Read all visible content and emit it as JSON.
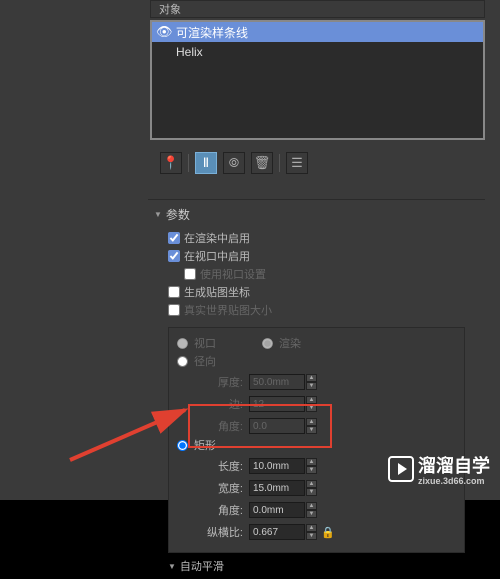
{
  "topbar": {
    "label": "对象"
  },
  "list": {
    "items": [
      {
        "label": "可渲染样条线",
        "selected": true,
        "eye": true
      },
      {
        "label": "Helix",
        "selected": false,
        "eye": false
      }
    ]
  },
  "toolbar": {
    "pin_icon": "📌",
    "info_icon": "ℹ",
    "lock_icon": "🔒",
    "trash_icon": "🗑",
    "config_icon": "⚙"
  },
  "params": {
    "section_title": "参数",
    "enable_render": {
      "label": "在渲染中启用",
      "checked": true
    },
    "enable_viewport": {
      "label": "在视口中启用",
      "checked": true
    },
    "use_viewport_settings": {
      "label": "使用视口设置",
      "checked": false
    },
    "gen_map_coords": {
      "label": "生成贴图坐标",
      "checked": false
    },
    "real_world_map": {
      "label": "真实世界贴图大小",
      "checked": false
    },
    "radial": {
      "viewport_label": "视口",
      "render_label": "渲染",
      "title": "径向",
      "thickness_label": "厚度:",
      "thickness_value": "50.0mm",
      "sides_label": "边:",
      "sides_value": "12",
      "angle_label": "角度:",
      "angle_value": "0.0"
    },
    "rect": {
      "title": "矩形",
      "length_label": "长度:",
      "length_value": "10.0mm",
      "width_label": "宽度:",
      "width_value": "15.0mm",
      "angle_label": "角度:",
      "angle_value": "0.0mm",
      "aspect_label": "纵横比:",
      "aspect_value": "0.667"
    },
    "auto_smooth": {
      "label": "自动平滑"
    }
  },
  "watermark": {
    "brand": "溜溜自学",
    "url": "zixue.3d66.com"
  }
}
